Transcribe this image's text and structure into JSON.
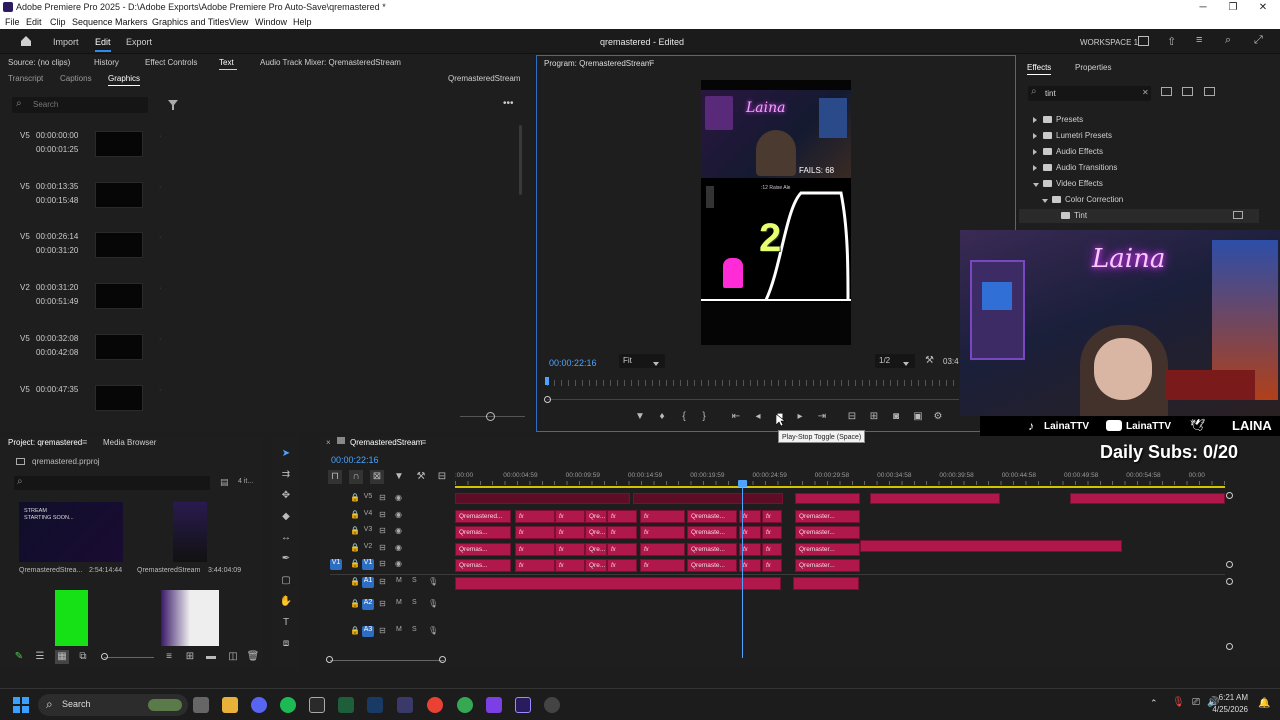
{
  "window": {
    "title": "Adobe Premiere Pro 2025 - D:\\Adobe Exports\\Adobe Premiere Pro Auto-Save\\qremastered *",
    "menu": [
      "File",
      "Edit",
      "Clip",
      "Sequence",
      "Markers",
      "Graphics and Titles",
      "View",
      "Window",
      "Help"
    ]
  },
  "header": {
    "tabs": [
      "Import",
      "Edit",
      "Export"
    ],
    "project_title": "qremastered - Edited",
    "workspace": "WORKSPACE 1"
  },
  "left_panel": {
    "tabs_row1": [
      "Source: (no clips)",
      "History",
      "Effect Controls",
      "Text",
      "Audio Track Mixer: QremasteredStream"
    ],
    "tabs_row2": [
      "Transcript",
      "Captions",
      "Graphics"
    ],
    "sequence_name": "QremasteredStream",
    "search_placeholder": "Search",
    "graphics": [
      {
        "track": "V5",
        "start": "00:00:00:00",
        "end": "00:00:01:25"
      },
      {
        "track": "V5",
        "start": "00:00:13:35",
        "end": "00:00:15:48"
      },
      {
        "track": "V5",
        "start": "00:00:26:14",
        "end": "00:00:31:20"
      },
      {
        "track": "V2",
        "start": "00:00:31:20",
        "end": "00:00:51:49"
      },
      {
        "track": "V5",
        "start": "00:00:32:08",
        "end": "00:00:42:08"
      },
      {
        "track": "V5",
        "start": "00:00:47:35",
        "end": ""
      }
    ]
  },
  "program": {
    "tab": "Program: QremasteredStream",
    "timecode": "00:00:22:16",
    "fit": "Fit",
    "resolution": "1/2",
    "duration_partial": "03:4",
    "video_overlay_name": "Laina",
    "fails": "FAILS: 68",
    "countdown": "2",
    "subtitle": ":12 Raise Ale"
  },
  "tooltip": "Play-Stop Toggle (Space)",
  "effects": {
    "tabs": [
      "Effects",
      "Properties"
    ],
    "search_value": "tint",
    "tree": [
      {
        "label": "Presets",
        "level": 0,
        "open": false
      },
      {
        "label": "Lumetri Presets",
        "level": 0,
        "open": false
      },
      {
        "label": "Audio Effects",
        "level": 0,
        "open": false
      },
      {
        "label": "Audio Transitions",
        "level": 0,
        "open": false
      },
      {
        "label": "Video Effects",
        "level": 0,
        "open": true
      },
      {
        "label": "Color Correction",
        "level": 1,
        "open": true
      },
      {
        "label": "Tint",
        "level": 2,
        "open": false
      }
    ]
  },
  "webcam": {
    "neon": "Laina",
    "socials": [
      "LainaTTV",
      "LainaTTV",
      "LAINA"
    ],
    "daily_subs": "Daily Subs: 0/20"
  },
  "project": {
    "tabs": [
      "Project: qremastered",
      "Media Browser"
    ],
    "file": "qremastered.prproj",
    "count": "4 it...",
    "items": [
      {
        "name": "QremasteredStrea...",
        "duration": "2:54:14:44",
        "thumb_text": "STREAM STARTING SOON..."
      },
      {
        "name": "QremasteredStream",
        "duration": "3:44:04:09",
        "thumb_text": ""
      },
      {
        "name": "",
        "duration": "",
        "thumb_text": ""
      },
      {
        "name": "",
        "duration": "",
        "thumb_text": ""
      }
    ]
  },
  "timeline": {
    "tab": "QremasteredStream",
    "timecode": "00:00:22:16",
    "ruler": [
      ":00:00",
      "00:00:04:59",
      "00:00:09:59",
      "00:00:14:59",
      "00:00:19:59",
      "00:00:24:59",
      "00:00:29:58",
      "00:00:34:58",
      "00:00:39:58",
      "00:00:44:58",
      "00:00:49:58",
      "00:00:54:58",
      "00:00"
    ],
    "video_tracks": [
      "V5",
      "V4",
      "V3",
      "V2",
      "V1"
    ],
    "audio_tracks": [
      "A1",
      "A2",
      "A3"
    ],
    "clip_labels": [
      "Qremastered...",
      "Qremas...",
      "Qre...",
      "Qremaste...",
      "Qremaster..."
    ],
    "fx": "fx"
  },
  "taskbar": {
    "search": "Search",
    "time": "6:21 AM",
    "date": "4/25/2026"
  }
}
